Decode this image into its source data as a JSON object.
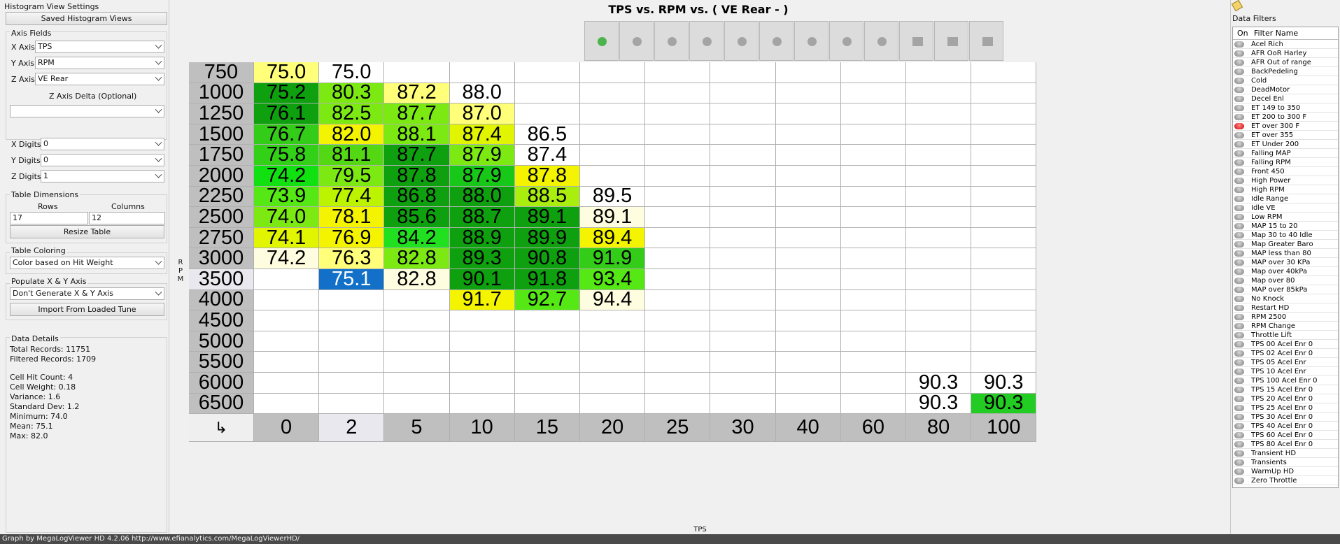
{
  "left": {
    "title": "Histogram View Settings",
    "saved_views_button": "Saved Histogram Views",
    "axis_fields_title": "Axis Fields",
    "x_axis_label": "X Axis:",
    "x_axis_value": "TPS",
    "y_axis_label": "Y Axis:",
    "y_axis_value": "RPM",
    "z_axis_label": "Z Axis:",
    "z_axis_value": "VE Rear",
    "z_delta_label": "Z Axis Delta (Optional)",
    "z_delta_value": "",
    "x_digits_label": "X Digits:",
    "x_digits_value": "0",
    "y_digits_label": "Y Digits:",
    "y_digits_value": "0",
    "z_digits_label": "Z Digits:",
    "z_digits_value": "1",
    "table_dim_title": "Table Dimensions",
    "rows_label": "Rows",
    "columns_label": "Columns",
    "rows_value": "17",
    "columns_value": "12",
    "resize_button": "Resize Table",
    "coloring_title": "Table Coloring",
    "coloring_value": "Color based on Hit Weight",
    "populate_title": "Populate X & Y Axis",
    "populate_value": "Don't Generate X & Y Axis",
    "import_button": "Import From Loaded Tune",
    "data_details_title": "Data Details",
    "total_records": "Total Records: 11751",
    "filtered_records": "Filtered Records: 1709",
    "cell_hit_count": "Cell Hit Count: 4",
    "cell_weight": "Cell Weight: 0.18",
    "variance": "Variance: 1.6",
    "std_dev": "Standard Dev: 1.2",
    "minimum": "Minimum: 74.0",
    "mean": "Mean: 75.1",
    "max": "Max: 82.0"
  },
  "main": {
    "title": "TPS vs. RPM vs. ( VE Rear -   )",
    "y_axis_label": [
      "R",
      "P",
      "M"
    ],
    "x_axis_label": "TPS",
    "corner_symbol": "↳",
    "toolbar_icons": [
      "zoom-green-icon",
      "pie-icon",
      "equal-icon",
      "arrow-up-icon",
      "arrow-down-icon",
      "minus-icon",
      "plus-icon",
      "close-icon",
      "pencil-icon",
      "rows-icon",
      "columns-icon",
      "grid-icon"
    ]
  },
  "table": {
    "row_headers": [
      "750",
      "1000",
      "1250",
      "1500",
      "1750",
      "2000",
      "2250",
      "2500",
      "2750",
      "3000",
      "3500",
      "4000",
      "4500",
      "5000",
      "5500",
      "6000",
      "6500"
    ],
    "col_headers": [
      "0",
      "2",
      "5",
      "10",
      "15",
      "20",
      "25",
      "30",
      "40",
      "60",
      "80",
      "100"
    ],
    "cells": [
      [
        "75.0",
        "75.0",
        "",
        "",
        "",
        "",
        "",
        "",
        "",
        "",
        "",
        ""
      ],
      [
        "75.2",
        "80.3",
        "87.2",
        "88.0",
        "",
        "",
        "",
        "",
        "",
        "",
        "",
        ""
      ],
      [
        "76.1",
        "82.5",
        "87.7",
        "87.0",
        "",
        "",
        "",
        "",
        "",
        "",
        "",
        ""
      ],
      [
        "76.7",
        "82.0",
        "88.1",
        "87.4",
        "86.5",
        "",
        "",
        "",
        "",
        "",
        "",
        ""
      ],
      [
        "75.8",
        "81.1",
        "87.7",
        "87.9",
        "87.4",
        "",
        "",
        "",
        "",
        "",
        "",
        ""
      ],
      [
        "74.2",
        "79.5",
        "87.8",
        "87.9",
        "87.8",
        "",
        "",
        "",
        "",
        "",
        "",
        ""
      ],
      [
        "73.9",
        "77.4",
        "86.8",
        "88.0",
        "88.5",
        "89.5",
        "",
        "",
        "",
        "",
        "",
        ""
      ],
      [
        "74.0",
        "78.1",
        "85.6",
        "88.7",
        "89.1",
        "89.1",
        "",
        "",
        "",
        "",
        "",
        ""
      ],
      [
        "74.1",
        "76.9",
        "84.2",
        "88.9",
        "89.9",
        "89.4",
        "",
        "",
        "",
        "",
        "",
        ""
      ],
      [
        "74.2",
        "76.3",
        "82.8",
        "89.3",
        "90.8",
        "91.9",
        "",
        "",
        "",
        "",
        "",
        ""
      ],
      [
        "",
        "75.1",
        "82.8",
        "90.1",
        "91.8",
        "93.4",
        "",
        "",
        "",
        "",
        "",
        ""
      ],
      [
        "",
        "",
        "",
        "91.7",
        "92.7",
        "94.4",
        "",
        "",
        "",
        "",
        "",
        ""
      ],
      [
        "",
        "",
        "",
        "",
        "",
        "",
        "",
        "",
        "",
        "",
        "",
        ""
      ],
      [
        "",
        "",
        "",
        "",
        "",
        "",
        "",
        "",
        "",
        "",
        "",
        ""
      ],
      [
        "",
        "",
        "",
        "",
        "",
        "",
        "",
        "",
        "",
        "",
        "",
        ""
      ],
      [
        "",
        "",
        "",
        "",
        "",
        "",
        "",
        "",
        "",
        "",
        "90.3",
        "90.3"
      ],
      [
        "",
        "",
        "",
        "",
        "",
        "",
        "",
        "",
        "",
        "",
        "90.3",
        "90.3"
      ]
    ],
    "colors": [
      [
        "#ffff7a",
        "#ffffff",
        "",
        "",
        "",
        "",
        "",
        "",
        "",
        "",
        "",
        ""
      ],
      [
        "#0ea00e",
        "#7cea12",
        "#ffff7a",
        "#ffffff",
        "",
        "",
        "",
        "",
        "",
        "",
        "",
        ""
      ],
      [
        "#0ea00e",
        "#7cea12",
        "#7cea12",
        "#ffff7a",
        "",
        "",
        "",
        "",
        "",
        "",
        "",
        ""
      ],
      [
        "#33cc18",
        "#f4f400",
        "#7cea12",
        "#e1f400",
        "#ffffff",
        "",
        "",
        "",
        "",
        "",
        "",
        ""
      ],
      [
        "#33d018",
        "#55d814",
        "#0ea00e",
        "#7cea12",
        "#ffffff",
        "",
        "",
        "",
        "",
        "",
        "",
        ""
      ],
      [
        "#11e011",
        "#7cea12",
        "#0ea00e",
        "#18c818",
        "#f4f400",
        "",
        "",
        "",
        "",
        "",
        "",
        ""
      ],
      [
        "#55e814",
        "#bcf400",
        "#0ea00e",
        "#0ea00e",
        "#aaee10",
        "#ffffff",
        "",
        "",
        "",
        "",
        "",
        ""
      ],
      [
        "#7cea12",
        "#f4f400",
        "#0ea00e",
        "#0ea00e",
        "#0ea00e",
        "#fffde0",
        "",
        "",
        "",
        "",
        "",
        ""
      ],
      [
        "#e1f400",
        "#f4f400",
        "#20e020",
        "#0ea00e",
        "#0ea00e",
        "#f4f400",
        "",
        "",
        "",
        "",
        "",
        ""
      ],
      [
        "#fffde0",
        "#ffff7a",
        "#7cea12",
        "#0ea00e",
        "#0ea00e",
        "#33cc18",
        "",
        "",
        "",
        "",
        "",
        ""
      ],
      [
        "",
        "#1270c8",
        "#fffde0",
        "#0ea00e",
        "#0ea00e",
        "#55e814",
        "",
        "",
        "",
        "",
        "",
        ""
      ],
      [
        "",
        "",
        "",
        "#f4f400",
        "#55e814",
        "#fffde0",
        "",
        "",
        "",
        "",
        "",
        ""
      ],
      [
        "",
        "",
        "",
        "",
        "",
        "",
        "",
        "",
        "",
        "",
        "",
        ""
      ],
      [
        "",
        "",
        "",
        "",
        "",
        "",
        "",
        "",
        "",
        "",
        "",
        ""
      ],
      [
        "",
        "",
        "",
        "",
        "",
        "",
        "",
        "",
        "",
        "",
        "",
        ""
      ],
      [
        "",
        "",
        "",
        "",
        "",
        "",
        "",
        "",
        "",
        "",
        "#ffffff",
        "#ffffff"
      ],
      [
        "",
        "",
        "",
        "",
        "",
        "",
        "",
        "",
        "",
        "",
        "#ffffff",
        "#22cc22"
      ]
    ],
    "selected_text_color": "#ffffff",
    "highlight_row_header": "3500",
    "highlight_col_header": "2"
  },
  "right": {
    "title": "Data Filters",
    "col_on": "On",
    "col_name": "Filter Name",
    "filters": [
      {
        "name": "Acel Rich",
        "on": false
      },
      {
        "name": "AFR OoR Harley",
        "on": false
      },
      {
        "name": "AFR Out of range",
        "on": false
      },
      {
        "name": "BackPedeling",
        "on": false
      },
      {
        "name": "Cold",
        "on": false
      },
      {
        "name": "DeadMotor",
        "on": false
      },
      {
        "name": "Decel Enl",
        "on": false
      },
      {
        "name": "ET 149 to 350",
        "on": false
      },
      {
        "name": "ET 200 to 300 F",
        "on": false
      },
      {
        "name": "ET over 300 F",
        "on": true
      },
      {
        "name": "ET over 355",
        "on": false
      },
      {
        "name": "ET Under 200",
        "on": false
      },
      {
        "name": "Falling MAP",
        "on": false
      },
      {
        "name": "Falling RPM",
        "on": false
      },
      {
        "name": "Front 450",
        "on": false
      },
      {
        "name": "High Power",
        "on": false
      },
      {
        "name": "High RPM",
        "on": false
      },
      {
        "name": "Idle Range",
        "on": false
      },
      {
        "name": "Idle VE",
        "on": false
      },
      {
        "name": "Low RPM",
        "on": false
      },
      {
        "name": "MAP 15 to 20",
        "on": false
      },
      {
        "name": "Map 30 to 40 Idle",
        "on": false
      },
      {
        "name": "Map Greater Baro",
        "on": false
      },
      {
        "name": "MAP less than 80",
        "on": false
      },
      {
        "name": "MAP over 30 KPa",
        "on": false
      },
      {
        "name": "Map over 40kPa",
        "on": false
      },
      {
        "name": "Map over 80",
        "on": false
      },
      {
        "name": "MAP over 85kPa",
        "on": false
      },
      {
        "name": "No Knock",
        "on": false
      },
      {
        "name": "Restart HD",
        "on": false
      },
      {
        "name": "RPM 2500",
        "on": false
      },
      {
        "name": "RPM Change",
        "on": false
      },
      {
        "name": "Throttle Lift",
        "on": false
      },
      {
        "name": "TPS 00 Acel Enr 0",
        "on": false
      },
      {
        "name": "TPS 02 Acel Enr 0",
        "on": false
      },
      {
        "name": "TPS 05 Acel Enr",
        "on": false
      },
      {
        "name": "TPS 10 Acel Enr",
        "on": false
      },
      {
        "name": "TPS 100 Acel Enr 0",
        "on": false
      },
      {
        "name": "TPS 15 Acel Enr 0",
        "on": false
      },
      {
        "name": "TPS 20 Acel Enr 0",
        "on": false
      },
      {
        "name": "TPS 25 Acel Enr 0",
        "on": false
      },
      {
        "name": "TPS 30 Acel Enr 0",
        "on": false
      },
      {
        "name": "TPS 40 Acel Enr 0",
        "on": false
      },
      {
        "name": "TPS 60 Acel Enr 0",
        "on": false
      },
      {
        "name": "TPS 80 Acel Enr 0",
        "on": false
      },
      {
        "name": "Transient HD",
        "on": false
      },
      {
        "name": "Transients",
        "on": false
      },
      {
        "name": "WarmUp HD",
        "on": false
      },
      {
        "name": "Zero Throttle",
        "on": false
      }
    ]
  },
  "status": "Graph by MegaLogViewer HD 4.2.06 http://www.efianalytics.com/MegaLogViewerHD/"
}
